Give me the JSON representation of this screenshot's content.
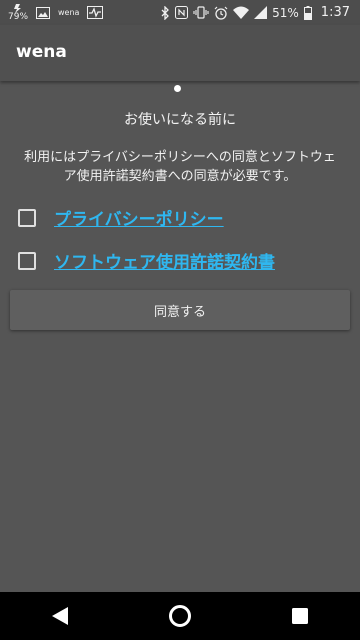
{
  "status_bar": {
    "notification_badge": "79%",
    "notification_app": "wena",
    "battery": "51%",
    "time": "1:37"
  },
  "app_bar": {
    "title": "wena"
  },
  "main": {
    "heading": "お使いになる前に",
    "description_line1": "利用にはプライバシーポリシーへの同意とソフトウェ",
    "description_line2": "ア使用許諾契約書への同意が必要です。",
    "links": [
      {
        "label": "プライバシーポリシー"
      },
      {
        "label": "ソフトウェア使用許諾契約書"
      }
    ],
    "agree_button": "同意する"
  },
  "colors": {
    "background": "#555555",
    "link": "#2fb7f0",
    "nav_bar": "#000000"
  }
}
